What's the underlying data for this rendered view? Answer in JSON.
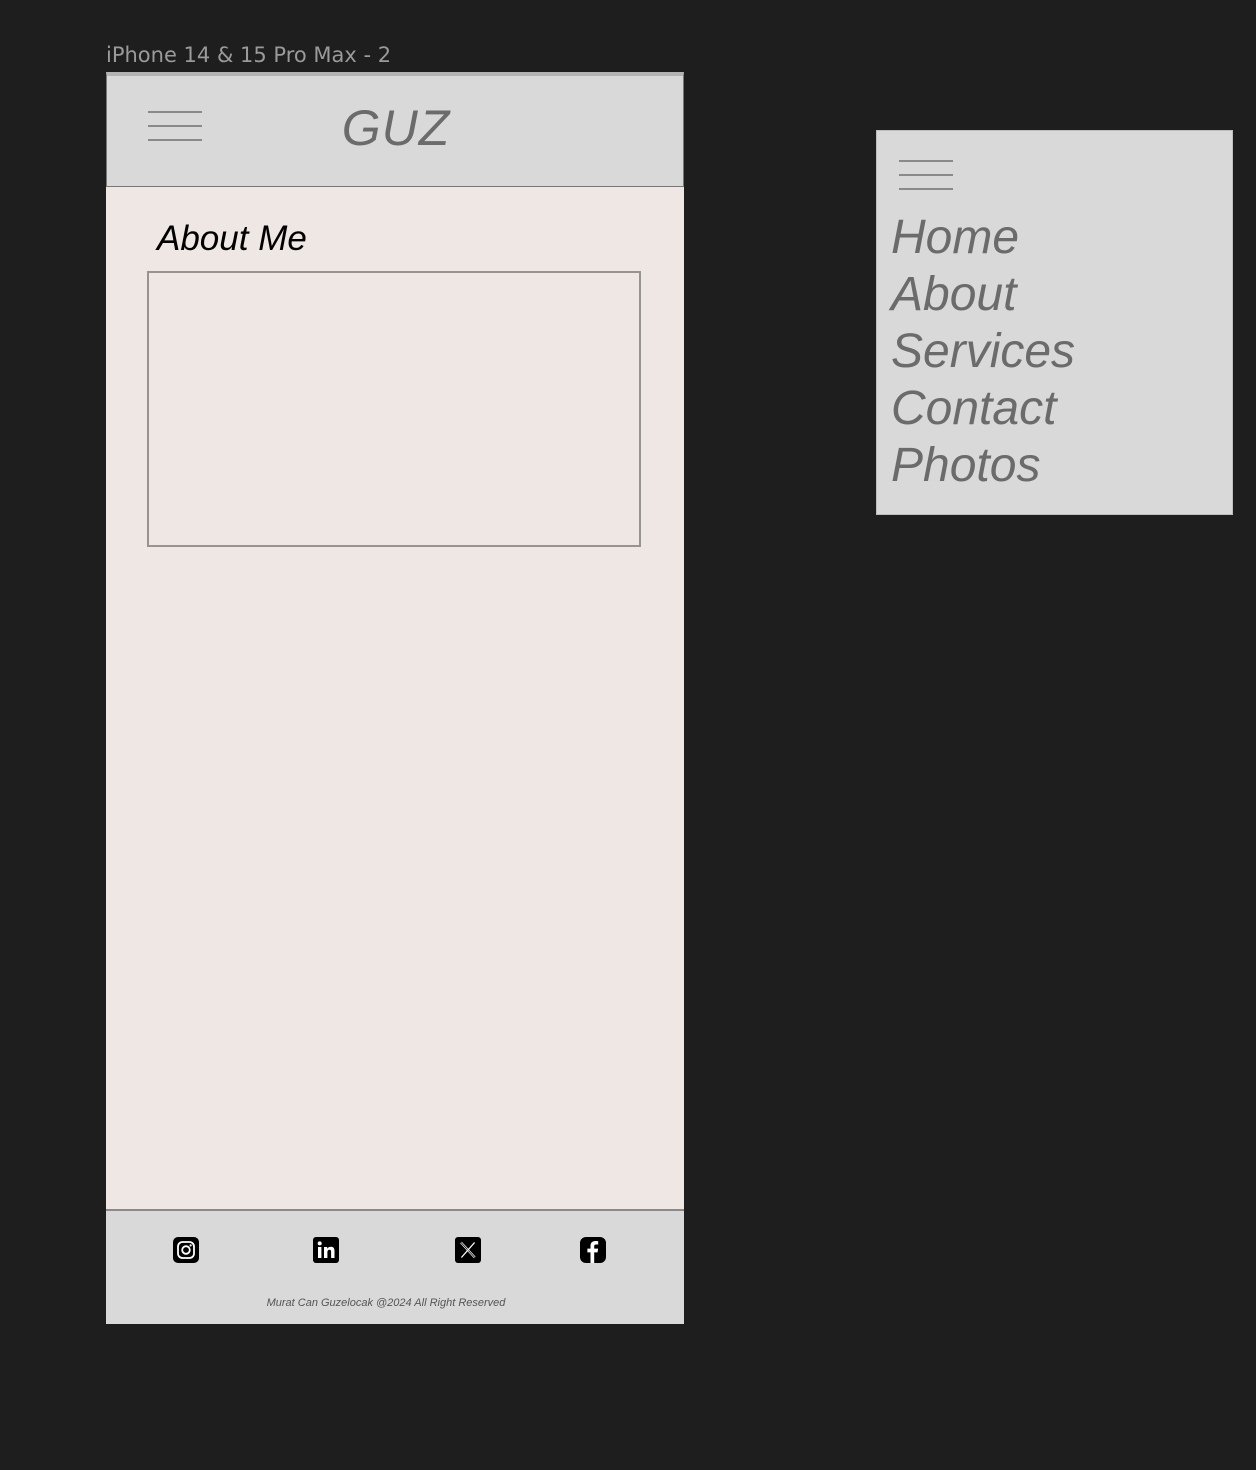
{
  "frame": {
    "label": "iPhone 14 & 15 Pro Max - 2"
  },
  "header": {
    "logo": "GUZ",
    "menu_icon": "hamburger-menu-icon"
  },
  "main": {
    "section_title": "About Me"
  },
  "footer": {
    "social_icons": [
      "instagram-icon",
      "linkedin-icon",
      "x-icon",
      "facebook-icon"
    ],
    "copyright": "Murat Can Guzelocak @2024 All Right Reserved"
  },
  "menu_panel": {
    "menu_icon": "hamburger-menu-icon",
    "items": [
      "Home",
      "About",
      "Services",
      "Contact",
      "Photos"
    ]
  },
  "colors": {
    "canvas": "#1e1e1e",
    "header_bg": "#d9d9d9",
    "page_bg": "#efe7e4",
    "text_gray": "#6b6b6b"
  }
}
